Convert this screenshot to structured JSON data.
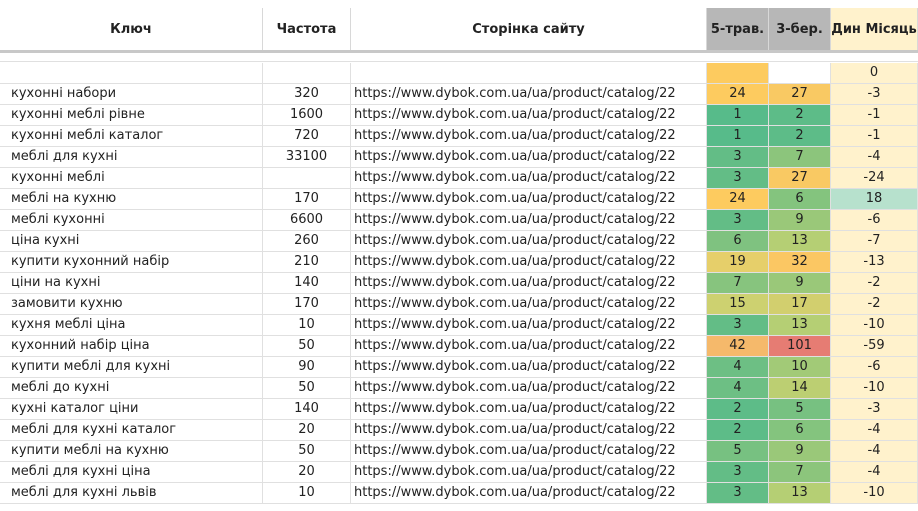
{
  "headers": {
    "key": "Ключ",
    "freq": "Частота",
    "page": "Сторінка сайту",
    "may5": "5-трав.",
    "mar3": "3-бер.",
    "dyn": "Дин Місяць"
  },
  "colors": {
    "header_gray": "#b7b7b7",
    "dyn_bg": "#fff2cc",
    "dyn_positive": "#b7e1cd",
    "green_dark": "#57bb8a",
    "green_mid": "#8cc57c",
    "green_light": "#b5cf74",
    "yellow": "#fdcb5f",
    "yellow_light": "#e6cf6a",
    "orange": "#f5b96b",
    "red": "#e67c73"
  },
  "rows": [
    {
      "key": "",
      "freq": "",
      "page": "",
      "may5": "",
      "mar3": "",
      "dyn": "0",
      "c1": "#fdcb5f",
      "c2": "#ffffff",
      "cd": "#fff2cc"
    },
    {
      "key": "кухонні набори",
      "freq": "320",
      "page": "https://www.dybok.com.ua/ua/product/catalog/22",
      "may5": "24",
      "mar3": "27",
      "dyn": "-3",
      "c1": "#fdcb5f",
      "c2": "#f9c963",
      "cd": "#fff2cc"
    },
    {
      "key": "кухонні меблі рівне",
      "freq": "1600",
      "page": "https://www.dybok.com.ua/ua/product/catalog/22",
      "may5": "1",
      "mar3": "2",
      "dyn": "-1",
      "c1": "#57bb8a",
      "c2": "#5dbc88",
      "cd": "#fff2cc"
    },
    {
      "key": "кухонні меблі каталог",
      "freq": "720",
      "page": "https://www.dybok.com.ua/ua/product/catalog/22",
      "may5": "1",
      "mar3": "2",
      "dyn": "-1",
      "c1": "#57bb8a",
      "c2": "#5dbc88",
      "cd": "#fff2cc"
    },
    {
      "key": "меблі для кухні",
      "freq": "33100",
      "page": "https://www.dybok.com.ua/ua/product/catalog/22",
      "may5": "3",
      "mar3": "7",
      "dyn": "-4",
      "c1": "#63bd86",
      "c2": "#8cc57c",
      "cd": "#fff2cc"
    },
    {
      "key": "кухонні меблі",
      "freq": "",
      "page": "https://www.dybok.com.ua/ua/product/catalog/22",
      "may5": "3",
      "mar3": "27",
      "dyn": "-24",
      "c1": "#63bd86",
      "c2": "#f9c963",
      "cd": "#fff2cc"
    },
    {
      "key": "меблі на кухню",
      "freq": "170",
      "page": "https://www.dybok.com.ua/ua/product/catalog/22",
      "may5": "24",
      "mar3": "6",
      "dyn": "18",
      "c1": "#fdcb5f",
      "c2": "#84c47e",
      "cd": "#b7e1cd"
    },
    {
      "key": "меблі кухонні",
      "freq": "6600",
      "page": "https://www.dybok.com.ua/ua/product/catalog/22",
      "may5": "3",
      "mar3": "9",
      "dyn": "-6",
      "c1": "#63bd86",
      "c2": "#9ac879",
      "cd": "#fff2cc"
    },
    {
      "key": "ціна кухні",
      "freq": "260",
      "page": "https://www.dybok.com.ua/ua/product/catalog/22",
      "may5": "6",
      "mar3": "13",
      "dyn": "-7",
      "c1": "#7fc280",
      "c2": "#b5cf74",
      "cd": "#fff2cc"
    },
    {
      "key": "купити кухонний набір",
      "freq": "210",
      "page": "https://www.dybok.com.ua/ua/product/catalog/22",
      "may5": "19",
      "mar3": "32",
      "dyn": "-13",
      "c1": "#e6cf6a",
      "c2": "#fbc763",
      "cd": "#fff2cc"
    },
    {
      "key": "ціни на кухні",
      "freq": "140",
      "page": "https://www.dybok.com.ua/ua/product/catalog/22",
      "may5": "7",
      "mar3": "9",
      "dyn": "-2",
      "c1": "#87c47e",
      "c2": "#9ac879",
      "cd": "#fff2cc"
    },
    {
      "key": "замовити кухню",
      "freq": "170",
      "page": "https://www.dybok.com.ua/ua/product/catalog/22",
      "may5": "15",
      "mar3": "17",
      "dyn": "-2",
      "c1": "#cdd170",
      "c2": "#d2cf6e",
      "cd": "#fff2cc"
    },
    {
      "key": "кухня меблі ціна",
      "freq": "10",
      "page": "https://www.dybok.com.ua/ua/product/catalog/22",
      "may5": "3",
      "mar3": "13",
      "dyn": "-10",
      "c1": "#63bd86",
      "c2": "#b5cf74",
      "cd": "#fff2cc"
    },
    {
      "key": "кухонний набір ціна",
      "freq": "50",
      "page": "https://www.dybok.com.ua/ua/product/catalog/22",
      "may5": "42",
      "mar3": "101",
      "dyn": "-59",
      "c1": "#f5b96b",
      "c2": "#e67c73",
      "cd": "#fff2cc"
    },
    {
      "key": "купити меблі для кухні",
      "freq": "90",
      "page": "https://www.dybok.com.ua/ua/product/catalog/22",
      "may5": "4",
      "mar3": "10",
      "dyn": "-6",
      "c1": "#6dbf84",
      "c2": "#a2ca77",
      "cd": "#fff2cc"
    },
    {
      "key": "меблі до кухні",
      "freq": "50",
      "page": "https://www.dybok.com.ua/ua/product/catalog/22",
      "may5": "4",
      "mar3": "14",
      "dyn": "-10",
      "c1": "#6dbf84",
      "c2": "#bccf72",
      "cd": "#fff2cc"
    },
    {
      "key": "кухні каталог ціни",
      "freq": "140",
      "page": "https://www.dybok.com.ua/ua/product/catalog/22",
      "may5": "2",
      "mar3": "5",
      "dyn": "-3",
      "c1": "#5dbc88",
      "c2": "#77c181",
      "cd": "#fff2cc"
    },
    {
      "key": "меблі для кухні каталог",
      "freq": "20",
      "page": "https://www.dybok.com.ua/ua/product/catalog/22",
      "may5": "2",
      "mar3": "6",
      "dyn": "-4",
      "c1": "#5dbc88",
      "c2": "#84c47e",
      "cd": "#fff2cc"
    },
    {
      "key": "купити меблі на кухню",
      "freq": "50",
      "page": "https://www.dybok.com.ua/ua/product/catalog/22",
      "may5": "5",
      "mar3": "9",
      "dyn": "-4",
      "c1": "#77c181",
      "c2": "#9ac879",
      "cd": "#fff2cc"
    },
    {
      "key": "меблі для кухні ціна",
      "freq": "20",
      "page": "https://www.dybok.com.ua/ua/product/catalog/22",
      "may5": "3",
      "mar3": "7",
      "dyn": "-4",
      "c1": "#63bd86",
      "c2": "#8cc57c",
      "cd": "#fff2cc"
    },
    {
      "key": "меблі для кухні львів",
      "freq": "10",
      "page": "https://www.dybok.com.ua/ua/product/catalog/22",
      "may5": "3",
      "mar3": "13",
      "dyn": "-10",
      "c1": "#63bd86",
      "c2": "#b5cf74",
      "cd": "#fff2cc"
    }
  ]
}
